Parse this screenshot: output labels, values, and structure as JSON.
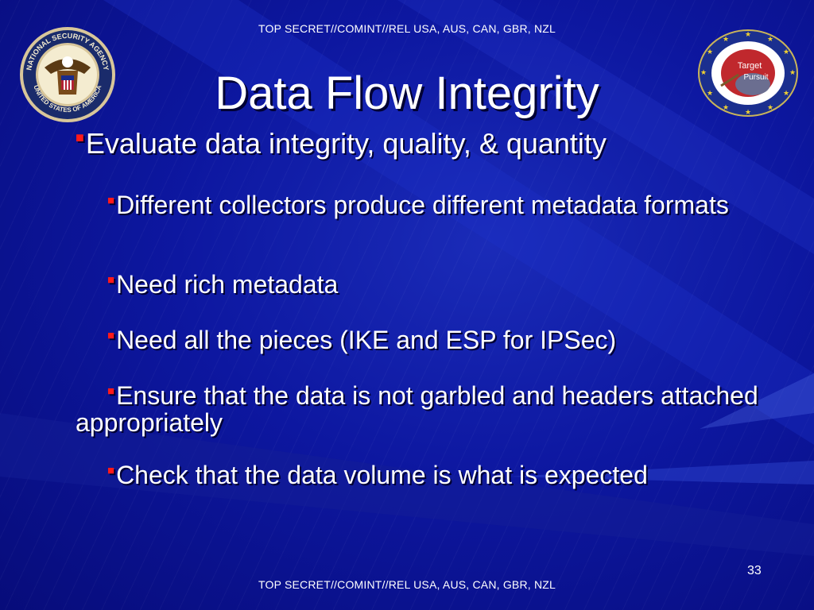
{
  "classification_top": "TOP SECRET//COMINT//REL USA, AUS, CAN, GBR, NZL",
  "classification_bottom": "TOP SECRET//COMINT//REL USA, AUS, CAN, GBR, NZL",
  "title": "Data Flow Integrity",
  "main_bullet": "Evaluate data integrity, quality, & quantity",
  "sub_bullets": [
    "Different collectors produce different metadata formats",
    "Need rich metadata",
    "Need all the pieces (IKE and ESP for IPSec)",
    "Ensure that the data is not garbled and headers attached appropriately",
    "Check that the data volume is what is expected"
  ],
  "slide_number": "33",
  "seal_text": "NATIONAL SECURITY AGENCY · UNITED STATES OF AMERICA",
  "logo_text_1": "Target",
  "logo_text_2": "Pursuit",
  "colors": {
    "background": "#0a0f8a",
    "bullet": "#ff1a1a",
    "text": "#ffffff"
  }
}
